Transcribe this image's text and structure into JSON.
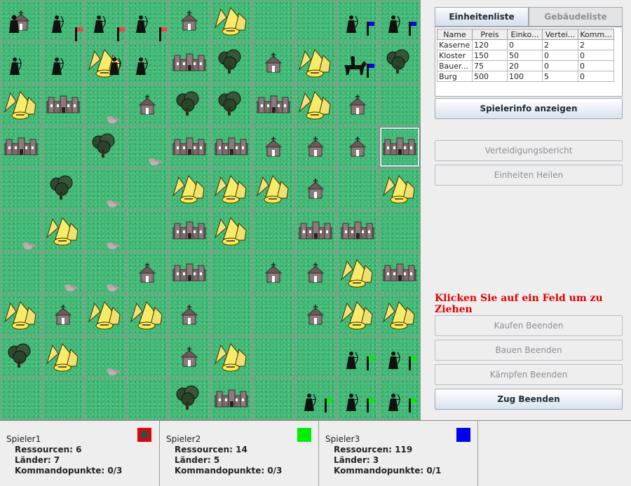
{
  "sidebar": {
    "tabs": {
      "units": "Einheitenliste",
      "buildings": "Gebäudeliste"
    },
    "table": {
      "columns": [
        "Name",
        "Preis",
        "Einko...",
        "Vertei...",
        "Komm..."
      ],
      "rows": [
        [
          "Kaserne",
          "120",
          "0",
          "2",
          "2"
        ],
        [
          "Kloster",
          "150",
          "50",
          "0",
          "0"
        ],
        [
          "Bauer...",
          "75",
          "20",
          "0",
          "0"
        ],
        [
          "Burg",
          "500",
          "100",
          "5",
          "0"
        ]
      ]
    },
    "buttons": {
      "player_info": "Spielerinfo anzeigen",
      "defense_report": "Verteidigungsbericht",
      "heal_units": "Einheiten Heilen",
      "end_buying": "Kaufen Beenden",
      "end_building": "Bauen Beenden",
      "end_fighting": "Kämpfen Beenden",
      "end_turn": "Zug Beenden"
    },
    "message": "Klicken Sie auf ein Feld um zu Ziehen"
  },
  "players": [
    {
      "name": "Spieler1",
      "resources": "Ressourcen: 6",
      "lands": "Länder: 7",
      "command": "Kommandopunkte: 0/3",
      "color": "#ee0000"
    },
    {
      "name": "Spieler2",
      "resources": "Ressourcen: 14",
      "lands": "Länder: 5",
      "command": "Kommandopunkte: 0/3",
      "color": "#00ee00"
    },
    {
      "name": "Spieler3",
      "resources": "Ressourcen: 119",
      "lands": "Länder: 3",
      "command": "Kommandopunkte: 0/1",
      "color": "#0000ee"
    }
  ],
  "board": {
    "colors": {
      "grass": "#3fb874",
      "flag_blue": "#0000ee",
      "flag_green": "#00ee00",
      "flag_red": "#ee4444"
    },
    "selected": [
      3,
      9
    ],
    "cells": [
      [
        "monk+chapel",
        "archer+redflag",
        "archer+redflag",
        "archer+redflag",
        "chapel",
        "farm",
        "",
        "",
        "archer+blueflag",
        "archer+blueflag"
      ],
      [
        "archer",
        "archer",
        "farm+archer",
        "archer",
        "castle",
        "tree",
        "chapel",
        "farm",
        "knight+blueflag",
        "tree"
      ],
      [
        "farm",
        "castle",
        "rocks",
        "chapel",
        "tree",
        "tree",
        "castle",
        "farm",
        "chapel",
        ""
      ],
      [
        "castle",
        "",
        "tree",
        "rocks",
        "castle",
        "castle",
        "chapel",
        "chapel",
        "chapel",
        "castle"
      ],
      [
        "",
        "tree",
        "rocks",
        "",
        "farm",
        "farm",
        "farm",
        "chapel",
        "",
        "farm"
      ],
      [
        "rocks",
        "farm",
        "rocks",
        "",
        "castle",
        "farm",
        "",
        "castle",
        "castle",
        ""
      ],
      [
        "",
        "rocks",
        "rocks",
        "chapel",
        "castle",
        "",
        "chapel",
        "chapel",
        "farm",
        "castle"
      ],
      [
        "farm",
        "chapel",
        "farm",
        "farm",
        "chapel",
        "",
        "",
        "chapel",
        "farm",
        "farm"
      ],
      [
        "tree",
        "farm",
        "rocks",
        "",
        "chapel",
        "farm",
        "",
        "",
        "archer+greenflag",
        "archer+greenflag"
      ],
      [
        "",
        "",
        "",
        "",
        "tree",
        "castle",
        "",
        "archer+greenflag",
        "archer+greenflag",
        "archer+greenflag"
      ]
    ]
  }
}
